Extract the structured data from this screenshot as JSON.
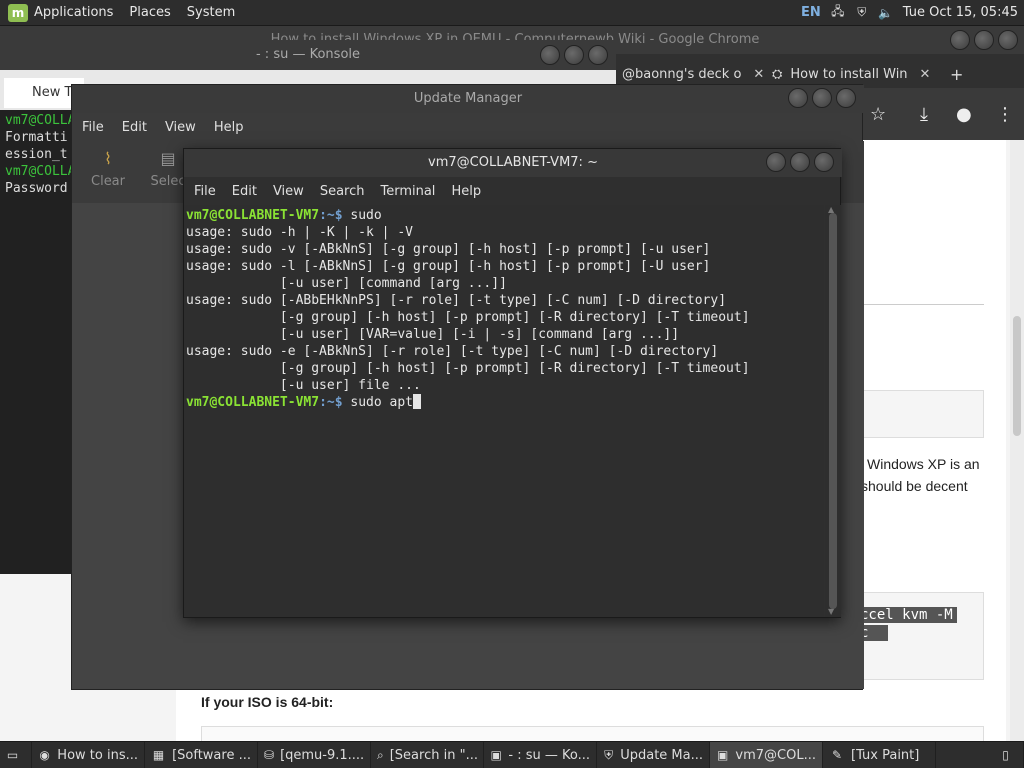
{
  "top_panel": {
    "menus": [
      "Applications",
      "Places",
      "System"
    ],
    "lang": "EN",
    "clock": "Tue Oct 15, 05:45"
  },
  "chrome": {
    "title": "How to install Windows XP in QEMU - Computernewb Wiki - Google Chrome",
    "tabs": [
      {
        "label": "New Ta"
      },
      {
        "label": "@baonng's deck o"
      },
      {
        "label": "How to install Win"
      }
    ],
    "article": {
      "text1": "Windows XP is an",
      "text2": "should be decent",
      "code1": "ccel kvm -M",
      "code2": "c",
      "heading": "If your ISO is 64-bit:"
    }
  },
  "konsole": {
    "title": "- : su — Konsole",
    "tab_label": "New Ta",
    "lines": [
      {
        "prefix": "vm7@COLLA",
        "rest": ""
      },
      {
        "prefix": "",
        "rest": "Formatti"
      },
      {
        "prefix": "",
        "rest": "ession_t"
      },
      {
        "prefix": "vm7@COLLA",
        "rest": ""
      },
      {
        "prefix": "",
        "rest": "Password"
      }
    ]
  },
  "update_manager": {
    "title": "Update Manager",
    "menus": [
      "File",
      "Edit",
      "View",
      "Help"
    ],
    "tools": [
      "Clear",
      "Selec"
    ]
  },
  "terminal": {
    "title": "vm7@COLLABNET-VM7: ~",
    "menus": [
      "File",
      "Edit",
      "View",
      "Search",
      "Terminal",
      "Help"
    ],
    "prompt_user": "vm7@COLLABNET-VM7",
    "prompt_path": ":~$",
    "lines": [
      {
        "type": "prompt",
        "cmd": " sudo"
      },
      {
        "type": "out",
        "text": "usage: sudo -h | -K | -k | -V"
      },
      {
        "type": "out",
        "text": "usage: sudo -v [-ABkNnS] [-g group] [-h host] [-p prompt] [-u user]"
      },
      {
        "type": "out",
        "text": "usage: sudo -l [-ABkNnS] [-g group] [-h host] [-p prompt] [-U user]"
      },
      {
        "type": "out",
        "text": "            [-u user] [command [arg ...]]"
      },
      {
        "type": "out",
        "text": "usage: sudo [-ABbEHkNnPS] [-r role] [-t type] [-C num] [-D directory]"
      },
      {
        "type": "out",
        "text": "            [-g group] [-h host] [-p prompt] [-R directory] [-T timeout]"
      },
      {
        "type": "out",
        "text": "            [-u user] [VAR=value] [-i | -s] [command [arg ...]]"
      },
      {
        "type": "out",
        "text": "usage: sudo -e [-ABkNnS] [-r role] [-t type] [-C num] [-D directory]"
      },
      {
        "type": "out",
        "text": "            [-g group] [-h host] [-p prompt] [-R directory] [-T timeout]"
      },
      {
        "type": "out",
        "text": "            [-u user] file ..."
      },
      {
        "type": "prompt",
        "cmd": " sudo apt"
      }
    ]
  },
  "taskbar": {
    "items": [
      {
        "label": "How to ins...",
        "icon": "chrome-icon"
      },
      {
        "label": "[Software ...",
        "icon": "software-icon"
      },
      {
        "label": "[qemu-9.1....",
        "icon": "disk-icon"
      },
      {
        "label": "[Search in \"...",
        "icon": "search-icon"
      },
      {
        "label": "- : su — Ko...",
        "icon": "terminal-icon"
      },
      {
        "label": "Update Ma...",
        "icon": "shield-icon"
      },
      {
        "label": "vm7@COL...",
        "icon": "terminal-icon"
      },
      {
        "label": "[Tux Paint]",
        "icon": "paint-icon"
      }
    ]
  }
}
